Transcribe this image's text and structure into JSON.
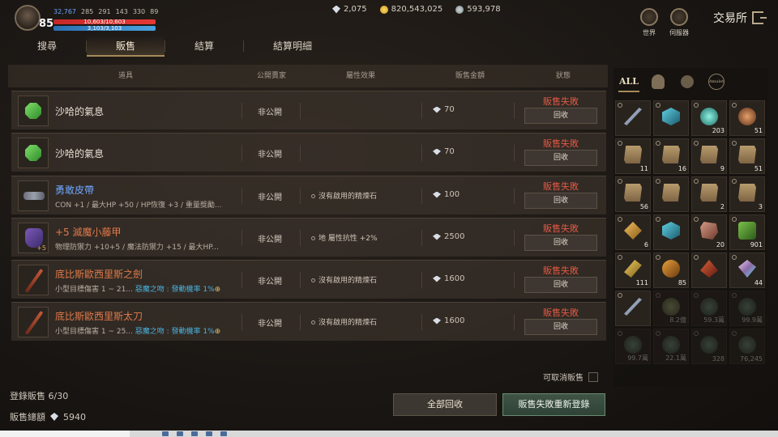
{
  "player": {
    "level": "85",
    "stats": [
      "32,767",
      "285",
      "291",
      "143",
      "330",
      "89"
    ],
    "hp": "10,603/10,603",
    "mp": "3,103/3,103"
  },
  "currency": {
    "diamond": "2,075",
    "gold": "820,543,025",
    "silver": "593,978"
  },
  "top_icons": {
    "world": "世界",
    "server": "伺服器"
  },
  "title": "交易所",
  "tabs": [
    "搜尋",
    "販售",
    "結算",
    "結算明細"
  ],
  "table": {
    "headers": {
      "item": "道具",
      "public": "公開賣家",
      "attr": "屬性效果",
      "price": "販售金額",
      "status": "狀態"
    },
    "rows": [
      {
        "name": "沙哈的氣息",
        "sub": "",
        "public": "非公開",
        "attr": "",
        "price": "70",
        "status": "販售失敗",
        "recall": "回收",
        "name_color": "white",
        "icon": "gem-icon"
      },
      {
        "name": "沙哈的氣息",
        "sub": "",
        "public": "非公開",
        "attr": "",
        "price": "70",
        "status": "販售失敗",
        "recall": "回收",
        "name_color": "white",
        "icon": "gem-icon"
      },
      {
        "name": "勇敢皮帶",
        "sub": "CON +1 / 最大HP +50 / HP恢復 +3 / 重量獎勵...",
        "public": "非公開",
        "attr": "沒有啟用的精煉石",
        "price": "100",
        "status": "販售失敗",
        "recall": "回收",
        "name_color": "blue",
        "icon": "belt-icon"
      },
      {
        "name": "+5 滅魔小藤甲",
        "sub": "物理防禦力 +10+5 / 魔法防禦力 +15 / 最大HP...",
        "public": "非公開",
        "attr": "地 屬性抗性 +2%",
        "price": "2500",
        "status": "販售失敗",
        "recall": "回收",
        "name_color": "orange",
        "icon": "armor-icon",
        "badge": "+5"
      },
      {
        "name": "底比斯歐西里斯之劍",
        "sub": "小型目標傷害 1 ~ 21...",
        "sub_hl": "惡魔之吻 : 發動機率 1%",
        "public": "非公開",
        "attr": "沒有啟用的精煉石",
        "price": "1600",
        "status": "販售失敗",
        "recall": "回收",
        "name_color": "orange",
        "icon": "sword-icon"
      },
      {
        "name": "底比斯歐西里斯太刀",
        "sub": "小型目標傷害 1 ~ 25...",
        "sub_hl": "惡魔之吻 : 發動機率 1%",
        "public": "非公開",
        "attr": "沒有啟用的精煉石",
        "price": "1600",
        "status": "販售失敗",
        "recall": "回收",
        "name_color": "orange",
        "icon": "sword-icon"
      }
    ]
  },
  "cancel_label": "可取消販售",
  "registered": "登錄販售  6/30",
  "total_label": "販售總額",
  "total_value": "5940",
  "buttons": {
    "recall_all": "全部回收",
    "reregister": "販售失敗重新登錄"
  },
  "inventory": {
    "tabs": [
      "ALL",
      "Amulet"
    ],
    "slots": [
      {
        "icon": "blade",
        "count": ""
      },
      {
        "icon": "cube",
        "count": ""
      },
      {
        "icon": "orb",
        "count": "203"
      },
      {
        "icon": "ring",
        "count": "51"
      },
      {
        "icon": "scroll",
        "count": "11"
      },
      {
        "icon": "scroll",
        "count": "16"
      },
      {
        "icon": "scroll",
        "count": "9"
      },
      {
        "icon": "scroll",
        "count": "51"
      },
      {
        "icon": "scroll",
        "count": "56"
      },
      {
        "icon": "scroll",
        "count": ""
      },
      {
        "icon": "scroll",
        "count": "2"
      },
      {
        "icon": "scroll",
        "count": "3"
      },
      {
        "icon": "cryst",
        "count": "6"
      },
      {
        "icon": "cube",
        "count": ""
      },
      {
        "icon": "ore",
        "count": "20"
      },
      {
        "icon": "green",
        "count": "901"
      },
      {
        "icon": "shard",
        "count": "111"
      },
      {
        "icon": "amber",
        "count": "85"
      },
      {
        "icon": "fire",
        "count": ""
      },
      {
        "icon": "prism",
        "count": "44"
      },
      {
        "icon": "blade",
        "count": ""
      },
      {
        "icon": "plant",
        "count": "8.2億",
        "dim": true
      },
      {
        "icon": "badge",
        "count": "59.3萬",
        "dim": true
      },
      {
        "icon": "badge",
        "count": "99.9萬",
        "dim": true
      },
      {
        "icon": "badge",
        "count": "99.7萬",
        "dim": true
      },
      {
        "icon": "badge",
        "count": "22.1萬",
        "dim": true
      },
      {
        "icon": "badge",
        "count": "328",
        "dim": true
      },
      {
        "icon": "badge",
        "count": "76,245",
        "dim": true
      }
    ]
  }
}
